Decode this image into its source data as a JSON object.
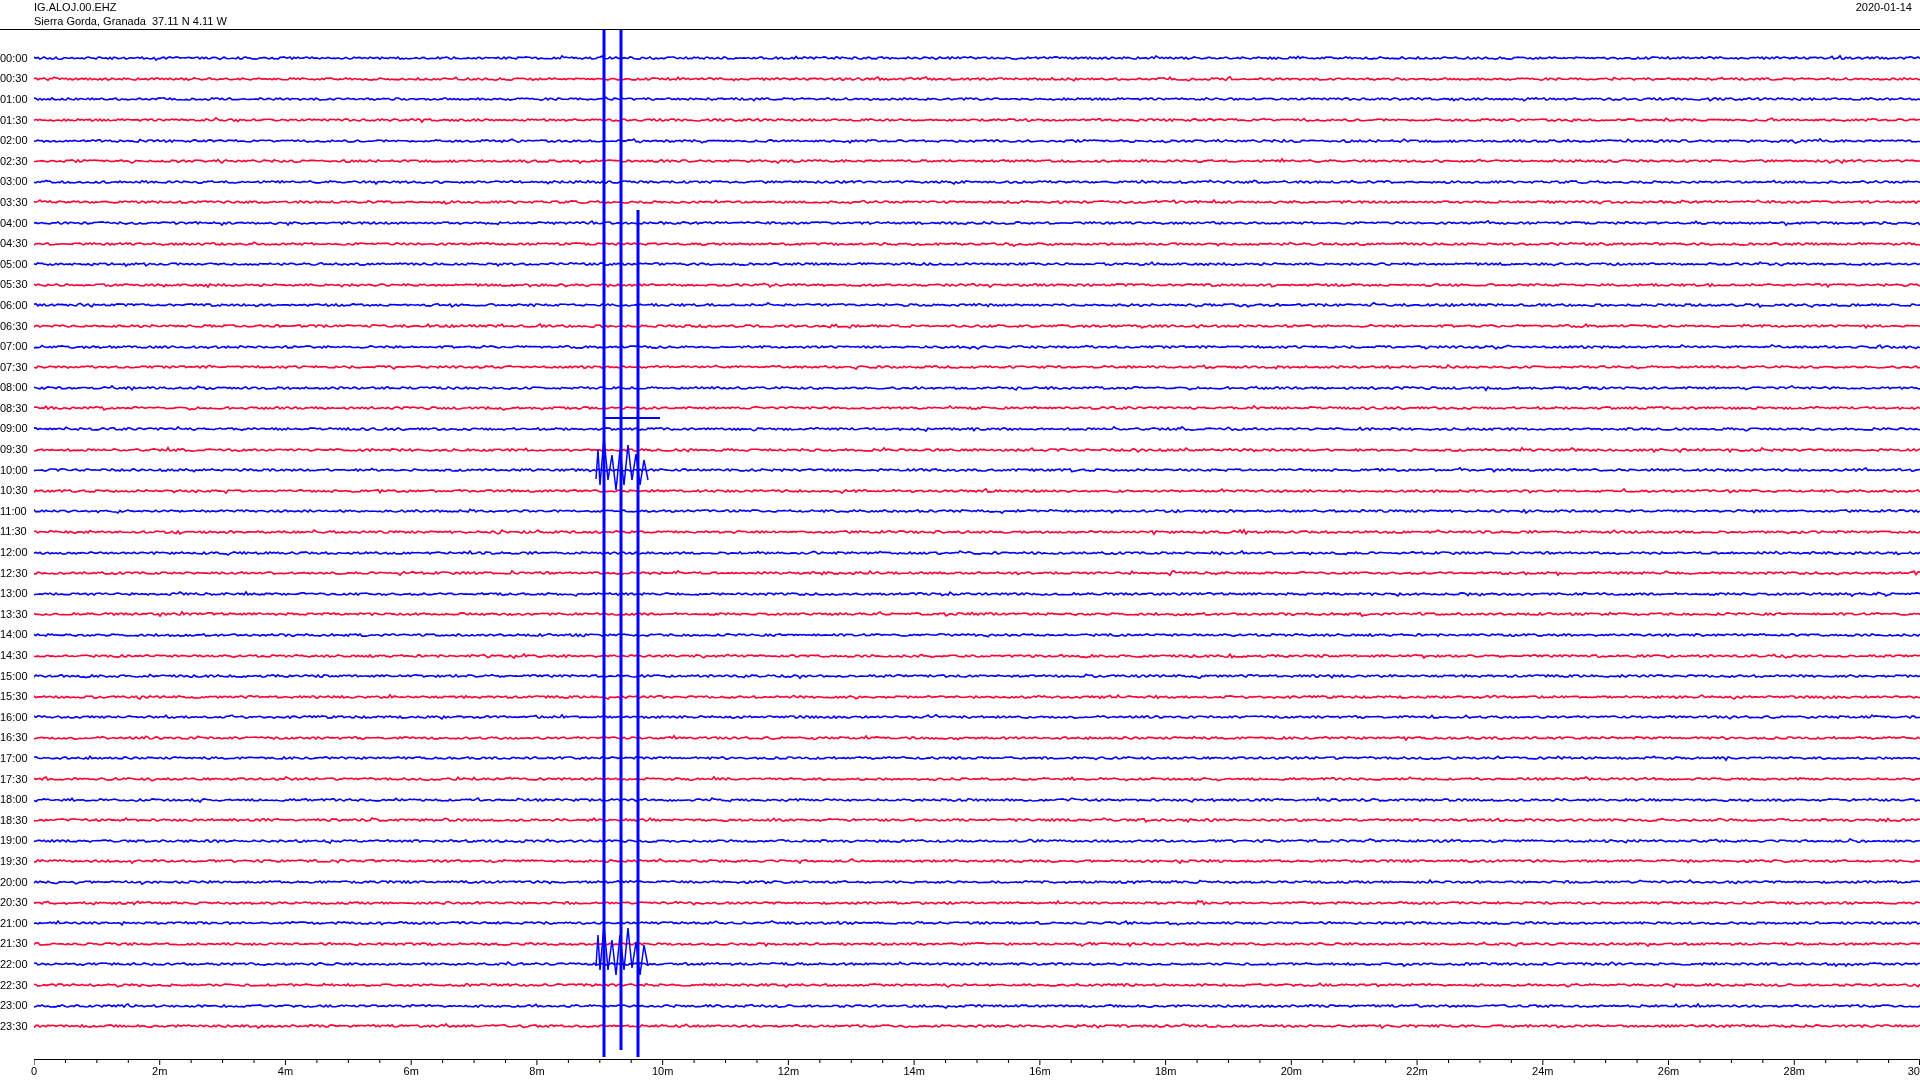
{
  "station": {
    "code": "IG.ALOJ.00.EHZ",
    "location": "Sierra Gorda, Granada  37.11 N 4.11 W"
  },
  "date": "2020-01-14",
  "rows": [
    {
      "label": "00:00",
      "color": "#0000ff"
    },
    {
      "label": "00:30",
      "color": "#ff0033"
    },
    {
      "label": "01:00",
      "color": "#0000ff"
    },
    {
      "label": "01:30",
      "color": "#ff0033"
    },
    {
      "label": "02:00",
      "color": "#0000ff"
    },
    {
      "label": "02:30",
      "color": "#ff0033"
    },
    {
      "label": "03:00",
      "color": "#0000ff"
    },
    {
      "label": "03:30",
      "color": "#ff0033"
    },
    {
      "label": "04:00",
      "color": "#0000ff"
    },
    {
      "label": "04:30",
      "color": "#ff0033"
    },
    {
      "label": "05:00",
      "color": "#0000ff"
    },
    {
      "label": "05:30",
      "color": "#ff0033"
    },
    {
      "label": "06:00",
      "color": "#0000ff"
    },
    {
      "label": "06:30",
      "color": "#ff0033"
    },
    {
      "label": "07:00",
      "color": "#0000ff"
    },
    {
      "label": "07:30",
      "color": "#ff0033"
    },
    {
      "label": "08:00",
      "color": "#0000ff"
    },
    {
      "label": "08:30",
      "color": "#ff0033"
    },
    {
      "label": "09:00",
      "color": "#0000ff"
    },
    {
      "label": "09:30",
      "color": "#ff0033"
    },
    {
      "label": "10:00",
      "color": "#0000ff"
    },
    {
      "label": "10:30",
      "color": "#ff0033"
    },
    {
      "label": "11:00",
      "color": "#0000ff"
    },
    {
      "label": "11:30",
      "color": "#ff0033"
    },
    {
      "label": "12:00",
      "color": "#0000ff"
    },
    {
      "label": "12:30",
      "color": "#ff0033"
    },
    {
      "label": "13:00",
      "color": "#0000ff"
    },
    {
      "label": "13:30",
      "color": "#ff0033"
    },
    {
      "label": "14:00",
      "color": "#0000ff"
    },
    {
      "label": "14:30",
      "color": "#ff0033"
    },
    {
      "label": "15:00",
      "color": "#0000ff"
    },
    {
      "label": "15:30",
      "color": "#ff0033"
    },
    {
      "label": "16:00",
      "color": "#0000ff"
    },
    {
      "label": "16:30",
      "color": "#ff0033"
    },
    {
      "label": "17:00",
      "color": "#0000ff"
    },
    {
      "label": "17:30",
      "color": "#ff0033"
    },
    {
      "label": "18:00",
      "color": "#0000ff"
    },
    {
      "label": "18:30",
      "color": "#ff0033"
    },
    {
      "label": "19:00",
      "color": "#0000ff"
    },
    {
      "label": "19:30",
      "color": "#ff0033"
    },
    {
      "label": "20:00",
      "color": "#0000ff"
    },
    {
      "label": "20:30",
      "color": "#ff0033"
    },
    {
      "label": "21:00",
      "color": "#0000ff"
    },
    {
      "label": "21:30",
      "color": "#ff0033"
    },
    {
      "label": "22:00",
      "color": "#0000ff"
    },
    {
      "label": "22:30",
      "color": "#ff0033"
    },
    {
      "label": "23:00",
      "color": "#0000ff"
    },
    {
      "label": "23:30",
      "color": "#ff0033"
    }
  ],
  "axis_labels": [
    "0",
    "2m",
    "4m",
    "6m",
    "8m",
    "10m",
    "12m",
    "14m",
    "16m",
    "18m",
    "20m",
    "22m",
    "24m",
    "26m",
    "28m",
    "30"
  ]
}
